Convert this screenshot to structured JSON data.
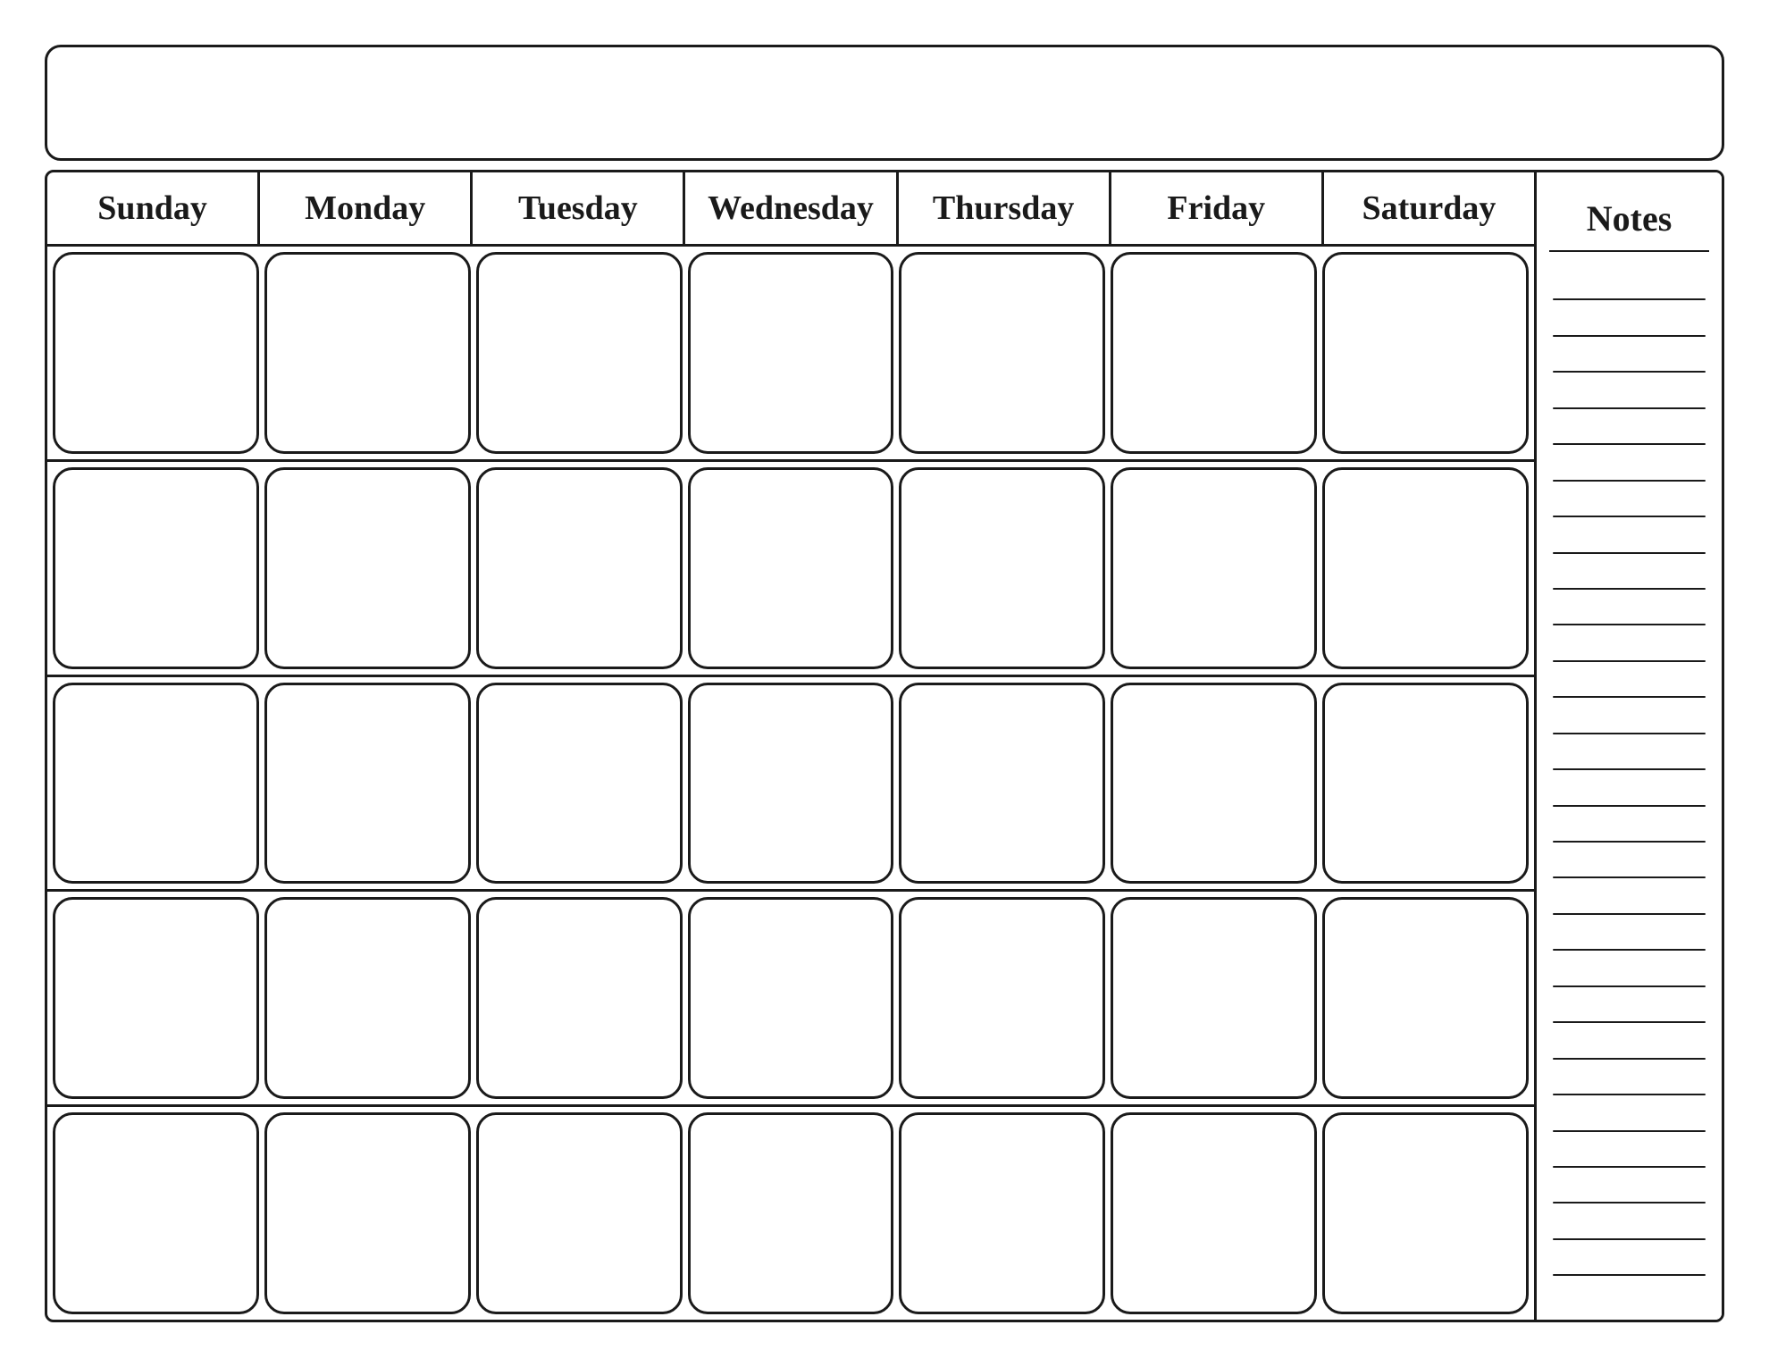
{
  "title": "",
  "days": [
    "Sunday",
    "Monday",
    "Tuesday",
    "Wednesday",
    "Thursday",
    "Friday",
    "Saturday"
  ],
  "notes_label": "Notes",
  "weeks": [
    [
      "",
      "",
      "",
      "",
      "",
      "",
      ""
    ],
    [
      "",
      "",
      "",
      "",
      "",
      "",
      ""
    ],
    [
      "",
      "",
      "",
      "",
      "",
      "",
      ""
    ],
    [
      "",
      "",
      "",
      "",
      "",
      "",
      ""
    ],
    [
      "",
      "",
      "",
      "",
      "",
      "",
      ""
    ]
  ],
  "notes_line_count": 28
}
